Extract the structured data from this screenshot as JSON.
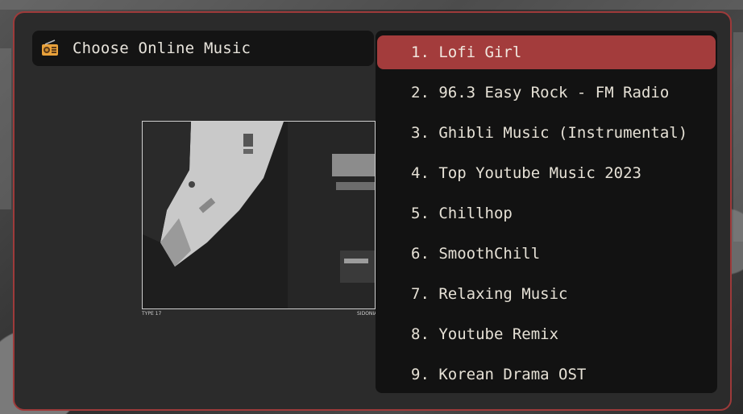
{
  "header": {
    "icon": "radio-icon",
    "title": "Choose Online Music"
  },
  "preview": {
    "caption_left": "TYPE 17",
    "caption_right": "SIDONIA"
  },
  "menu": {
    "selected_index": 0,
    "items": [
      {
        "label": "1. Lofi Girl"
      },
      {
        "label": "2. 96.3 Easy Rock - FM Radio"
      },
      {
        "label": "3. Ghibli Music (Instrumental)"
      },
      {
        "label": "4. Top Youtube Music 2023"
      },
      {
        "label": "5. Chillhop"
      },
      {
        "label": "6. SmoothChill"
      },
      {
        "label": "7. Relaxing Music"
      },
      {
        "label": "8. Youtube Remix"
      },
      {
        "label": "9. Korean Drama OST"
      }
    ]
  },
  "colors": {
    "accent": "#a33c3c",
    "window_border": "#9e3a3a",
    "panel_bg": "#121212",
    "window_bg": "#2b2b2b",
    "text": "#e6e1d6"
  }
}
